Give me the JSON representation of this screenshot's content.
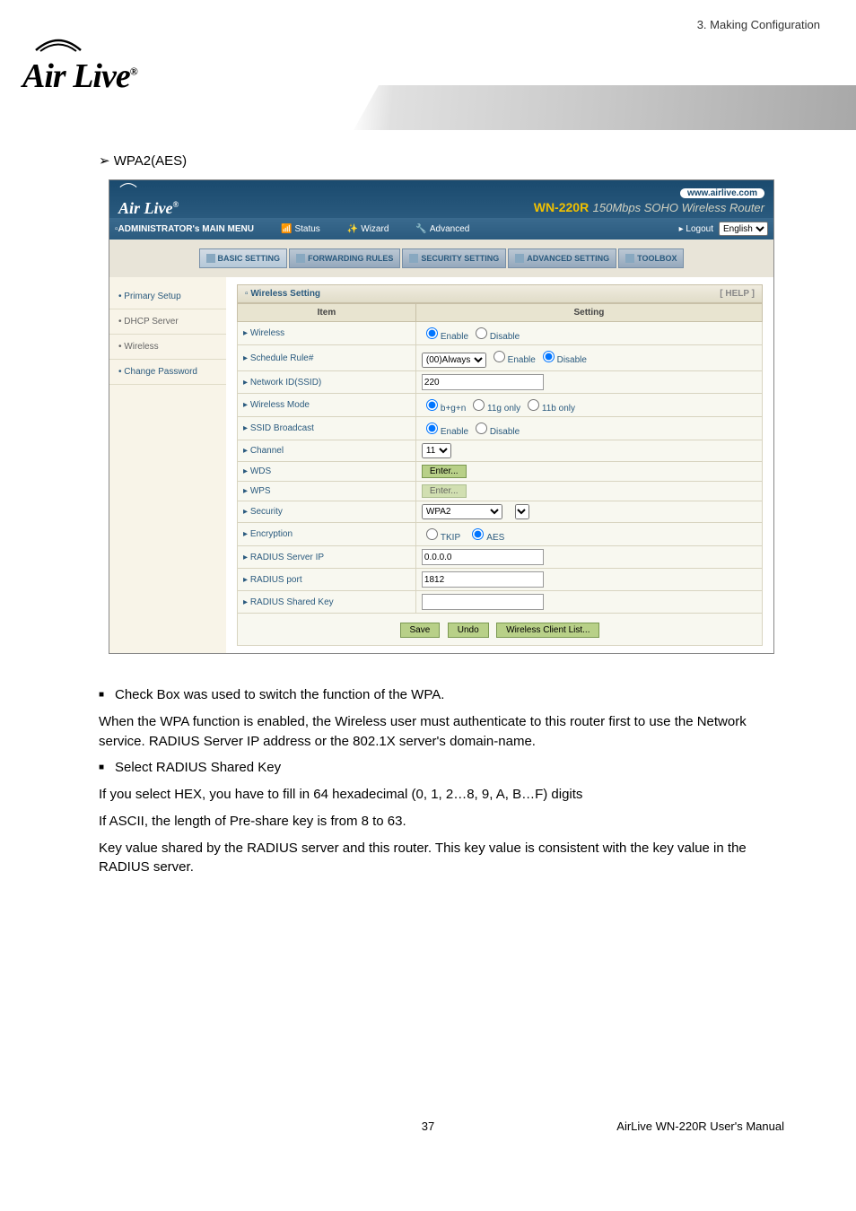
{
  "chapter": "3.  Making  Configuration",
  "logo": "Air Live",
  "section_heading": "WPA2(AES)",
  "router": {
    "url": "www.airlive.com",
    "model": "WN-220R",
    "model_sub": "150Mbps SOHO Wireless Router",
    "nav": {
      "admin_menu": "ADMINISTRATOR's MAIN MENU",
      "status": "Status",
      "wizard": "Wizard",
      "advanced": "Advanced",
      "logout": "Logout",
      "language": "English"
    },
    "tabs": {
      "basic": "BASIC SETTING",
      "forwarding": "FORWARDING RULES",
      "security": "SECURITY SETTING",
      "advanced": "ADVANCED SETTING",
      "toolbox": "TOOLBOX"
    },
    "sidebar": {
      "primary": "Primary Setup",
      "dhcp": "DHCP Server",
      "wireless": "Wireless",
      "change_pw": "Change Password"
    },
    "panel": {
      "title": "Wireless Setting",
      "help": "[ HELP ]",
      "col_item": "Item",
      "col_setting": "Setting",
      "rows": {
        "wireless": "Wireless",
        "schedule": "Schedule Rule#",
        "ssid": "Network ID(SSID)",
        "mode": "Wireless Mode",
        "broadcast": "SSID Broadcast",
        "channel": "Channel",
        "wds": "WDS",
        "wps": "WPS",
        "security": "Security",
        "encryption": "Encryption",
        "radius_ip": "RADIUS Server IP",
        "radius_port": "RADIUS port",
        "radius_key": "RADIUS Shared Key"
      },
      "values": {
        "enable": "Enable",
        "disable": "Disable",
        "schedule_sel": "(00)Always",
        "ssid_val": "220",
        "mode_bgn": "b+g+n",
        "mode_11g": "11g only",
        "mode_11b": "11b only",
        "channel_val": "11",
        "enter": "Enter...",
        "security_val": "WPA2",
        "tkip": "TKIP",
        "aes": "AES",
        "radius_ip_val": "0.0.0.0",
        "radius_port_val": "1812",
        "radius_key_val": ""
      },
      "buttons": {
        "save": "Save",
        "undo": "Undo",
        "client_list": "Wireless Client List..."
      }
    }
  },
  "body_text": {
    "p1": "Check Box was used to switch the function of the WPA.",
    "p2": "When the WPA function is enabled, the Wireless user must authenticate to this router first to use the Network service. RADIUS Server IP address or the 802.1X server's domain-name.",
    "p3": "Select RADIUS Shared Key",
    "p4": "If you select HEX, you have to fill in 64 hexadecimal (0, 1, 2…8, 9, A, B…F) digits",
    "p5": "If ASCII, the length of Pre-share key is from 8 to 63.",
    "p6": "Key value shared by the RADIUS server and this router. This key value is consistent with the key value in the RADIUS server."
  },
  "footer": {
    "page": "37",
    "manual": "AirLive  WN-220R  User's  Manual"
  }
}
